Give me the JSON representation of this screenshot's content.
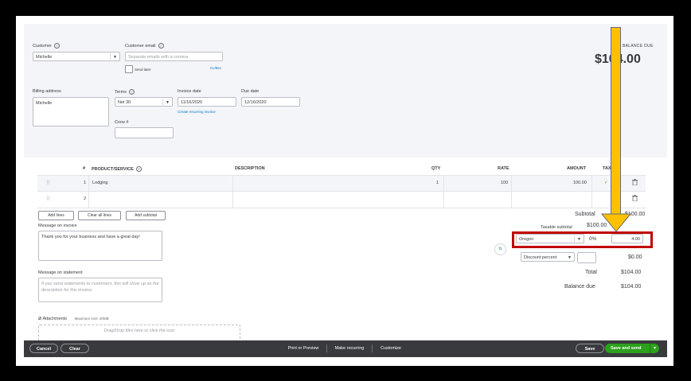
{
  "customer": {
    "label": "Customer",
    "value": "Michelle"
  },
  "customer_email": {
    "label": "Customer email",
    "placeholder": "Separate emails with a comma",
    "send_later": "Send later",
    "cc_bcc": "Cc/Bcc"
  },
  "balance": {
    "label": "BALANCE DUE",
    "amount": "$104.00"
  },
  "billing_address": {
    "label": "Billing address",
    "value": "Michelle"
  },
  "terms": {
    "label": "Terms",
    "value": "Net 30"
  },
  "invoice_date": {
    "label": "Invoice date",
    "value": "11/16/2020",
    "link": "Create recurring invoice"
  },
  "due_date": {
    "label": "Due date",
    "value": "12/16/2020"
  },
  "crew": {
    "label": "Crew #",
    "value": ""
  },
  "table": {
    "headers": {
      "num": "#",
      "product": "PRODUCT/SERVICE",
      "description": "DESCRIPTION",
      "qty": "QTY",
      "rate": "RATE",
      "amount": "AMOUNT",
      "tax": "TAX"
    },
    "rows": [
      {
        "num": "1",
        "product": "Lodging",
        "description": "",
        "qty": "1",
        "rate": "100",
        "amount": "100.00",
        "tax": "✓"
      },
      {
        "num": "2",
        "product": "",
        "description": "",
        "qty": "",
        "rate": "",
        "amount": "",
        "tax": ""
      }
    ]
  },
  "line_buttons": {
    "add_lines": "Add lines",
    "clear_all": "Clear all lines",
    "add_subtotal": "Add subtotal"
  },
  "message_invoice": {
    "label": "Message on invoice",
    "value": "Thank you for your business and have a great day!"
  },
  "message_statement": {
    "label": "Message on statement",
    "placeholder": "If you send statements to customers, this will show up as the description for this invoice."
  },
  "attachments": {
    "label": "Attachments",
    "max": "Maximum size: 20MB",
    "drop": "Drag/Drop files here or click the icon"
  },
  "totals": {
    "subtotal_label": "Subtotal",
    "subtotal": "$100.00",
    "taxable_label": "Taxable subtotal",
    "taxable": "$100.00",
    "tax_rate_name": "Oregon",
    "tax_percent": "0%",
    "tax_amount": "4.00",
    "discount_type": "Discount percent",
    "discount_value": "",
    "discount_amount": "$0.00",
    "total_label": "Total",
    "total": "$104.00",
    "balance_due_label": "Balance due",
    "balance_due": "$104.00"
  },
  "footer": {
    "cancel": "Cancel",
    "clear": "Clear",
    "print": "Print or Preview",
    "recurring": "Make recurring",
    "customize": "Customize",
    "save": "Save",
    "save_send": "Save and send"
  },
  "colors": {
    "highlight_box": "#c00000",
    "arrow": "#ffc000",
    "primary_green": "#2ca01c",
    "link_blue": "#0077c5"
  },
  "icons": [
    "help-icon",
    "dropdown-caret-icon",
    "drag-handle-icon",
    "trash-icon",
    "checkmark-icon",
    "paperclip-icon",
    "tax-swap-icon",
    "arrow-down-annotation"
  ]
}
